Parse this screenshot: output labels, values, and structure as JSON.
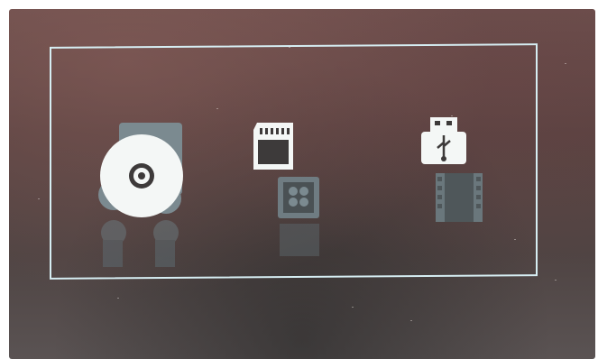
{
  "menu": {
    "items": [
      {
        "name": "disc",
        "icon": "disc-icon"
      },
      {
        "name": "sd-card",
        "icon": "sd-card-icon"
      },
      {
        "name": "usb",
        "icon": "usb-icon"
      }
    ],
    "secondary_icons": [
      "music-icon",
      "memory-card-icon",
      "film-icon"
    ],
    "colors": {
      "frame": "#d6eef3",
      "active_icon": "#f4f7f6",
      "inactive_icon": "#7b8a90",
      "background": "#574241"
    }
  }
}
